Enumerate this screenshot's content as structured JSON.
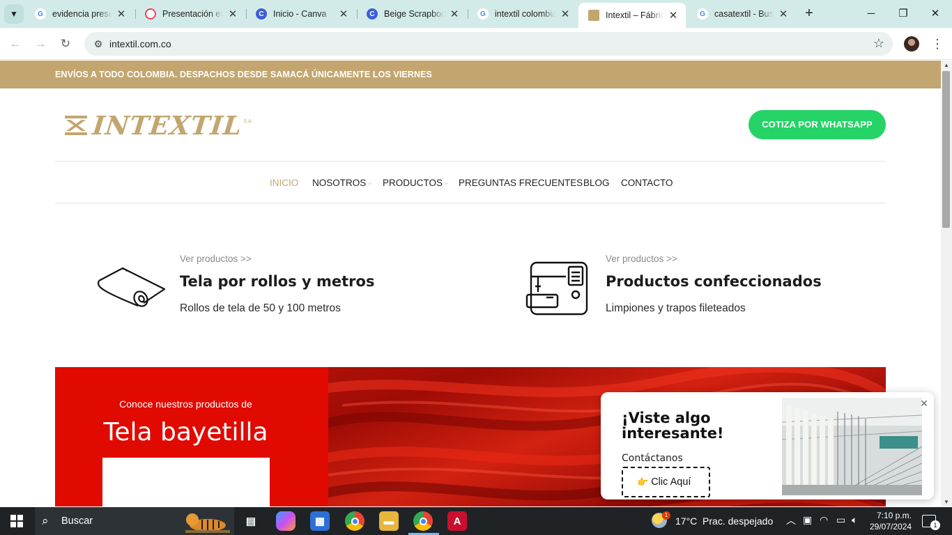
{
  "browser": {
    "tabs": [
      {
        "title": "evidencia presen",
        "icon": "google-icon",
        "color": "#4285f4"
      },
      {
        "title": "Presentación en",
        "icon": "slides-icon",
        "color": "#e8455a"
      },
      {
        "title": "Inicio - Canva",
        "icon": "canva-icon",
        "color": "#3e5ed8"
      },
      {
        "title": "Beige Scrapbook",
        "icon": "canva-icon",
        "color": "#3e5ed8"
      },
      {
        "title": "intextil colombia",
        "icon": "google-icon",
        "color": "#4285f4"
      },
      {
        "title": "Intextil – Fábrica",
        "icon": "intextil-favicon",
        "color": "#c3a66f"
      },
      {
        "title": "casatextil - Busc",
        "icon": "google-icon",
        "color": "#4285f4"
      }
    ],
    "url": "intextil.com.co"
  },
  "site": {
    "announcement": "ENVÍOS A TODO COLOMBIA. DESPACHOS DESDE SAMACÁ ÚNICAMENTE LOS VIERNES",
    "logo_text": "INTEXTIL",
    "logo_suffix": "S.A.",
    "whatsapp_button": "COTIZA POR WHATSAPP",
    "nav": [
      {
        "label": "INICIO",
        "active": true
      },
      {
        "label": "NOSOTROS",
        "dropdown": true
      },
      {
        "label": "PRODUCTOS",
        "dropdown": true
      },
      {
        "label": "PREGUNTAS FRECUENTES"
      },
      {
        "label": "BLOG"
      },
      {
        "label": "CONTACTO"
      }
    ],
    "features": [
      {
        "link": "Ver productos >>",
        "title": "Tela por rollos y metros",
        "desc": "Rollos de tela de 50 y 100 metros",
        "icon": "fabric-roll-icon"
      },
      {
        "link": "Ver productos >>",
        "title": "Productos confeccionados",
        "desc": "Limpiones y trapos fileteados",
        "icon": "sewing-machine-icon"
      }
    ],
    "banner": {
      "subtitle": "Conoce nuestros productos de",
      "title": "Tela bayetilla"
    },
    "popup": {
      "title": "¡Viste algo interesante!",
      "subtitle": "Contáctanos",
      "cta": "Clic Aquí"
    }
  },
  "taskbar": {
    "search_label": "Buscar",
    "weather": "17°C  Prac. despejado",
    "weather_badge": "1",
    "time": "7:10 p.m.",
    "date": "29/07/2024",
    "notifications": "1"
  },
  "colors": {
    "brand_gold": "#c3a66f",
    "whatsapp_green": "#25d366",
    "banner_red": "#e10a00"
  }
}
